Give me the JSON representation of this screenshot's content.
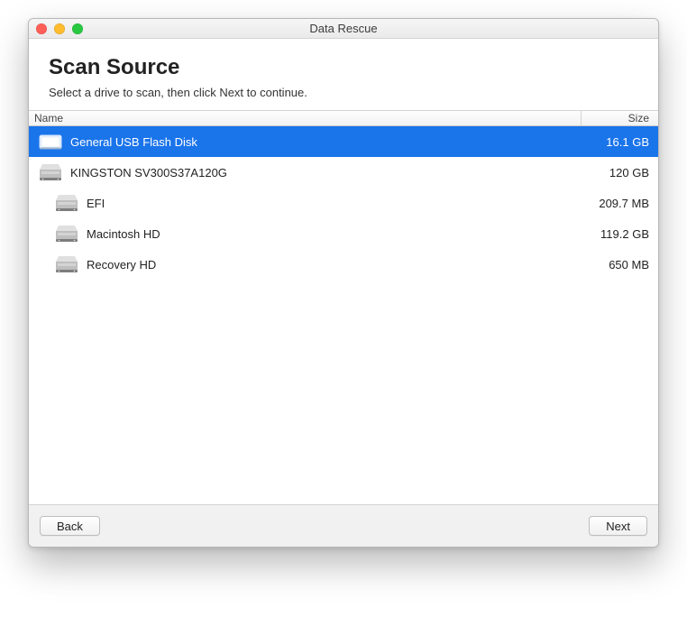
{
  "window": {
    "title": "Data Rescue"
  },
  "header": {
    "title": "Scan Source",
    "subtitle": "Select a drive to scan, then click Next to continue."
  },
  "columns": {
    "name": "Name",
    "size": "Size"
  },
  "drives": [
    {
      "name": "General USB Flash Disk",
      "size": "16.1 GB",
      "icon": "usb",
      "indent": 0,
      "selected": true
    },
    {
      "name": "KINGSTON SV300S37A120G",
      "size": "120 GB",
      "icon": "hdd",
      "indent": 0,
      "selected": false
    },
    {
      "name": "EFI",
      "size": "209.7 MB",
      "icon": "hdd",
      "indent": 1,
      "selected": false
    },
    {
      "name": "Macintosh HD",
      "size": "119.2 GB",
      "icon": "hdd",
      "indent": 1,
      "selected": false
    },
    {
      "name": "Recovery HD",
      "size": "650 MB",
      "icon": "hdd",
      "indent": 1,
      "selected": false
    }
  ],
  "buttons": {
    "back": "Back",
    "next": "Next"
  }
}
